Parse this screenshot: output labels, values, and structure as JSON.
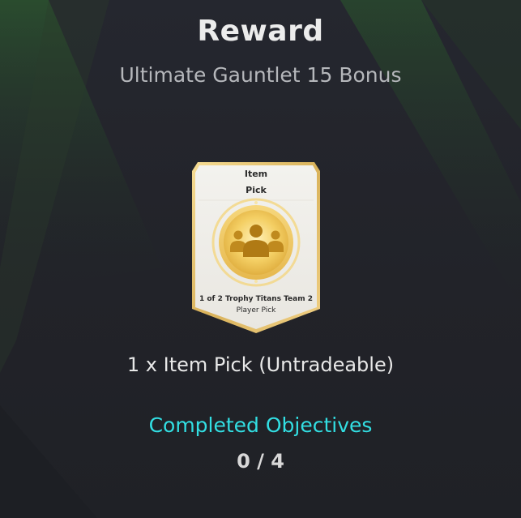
{
  "header": {
    "title": "Reward",
    "subtitle": "Ultimate Gauntlet 15 Bonus"
  },
  "card": {
    "title_line1": "Item",
    "title_line2": "Pick",
    "desc_line1": "1 of 2 Trophy Titans Team 2",
    "desc_line2": "Player Pick",
    "icon": "players-group-icon"
  },
  "reward": {
    "text": "1 x Item Pick (Untradeable)"
  },
  "objectives": {
    "label": "Completed Objectives",
    "count": "0 / 4"
  },
  "colors": {
    "background": "#23252c",
    "accent_cyan": "#32dfe3",
    "card_gold": "#e7c670",
    "card_face": "#efeeea",
    "glow_green": "#2f6b2c"
  }
}
